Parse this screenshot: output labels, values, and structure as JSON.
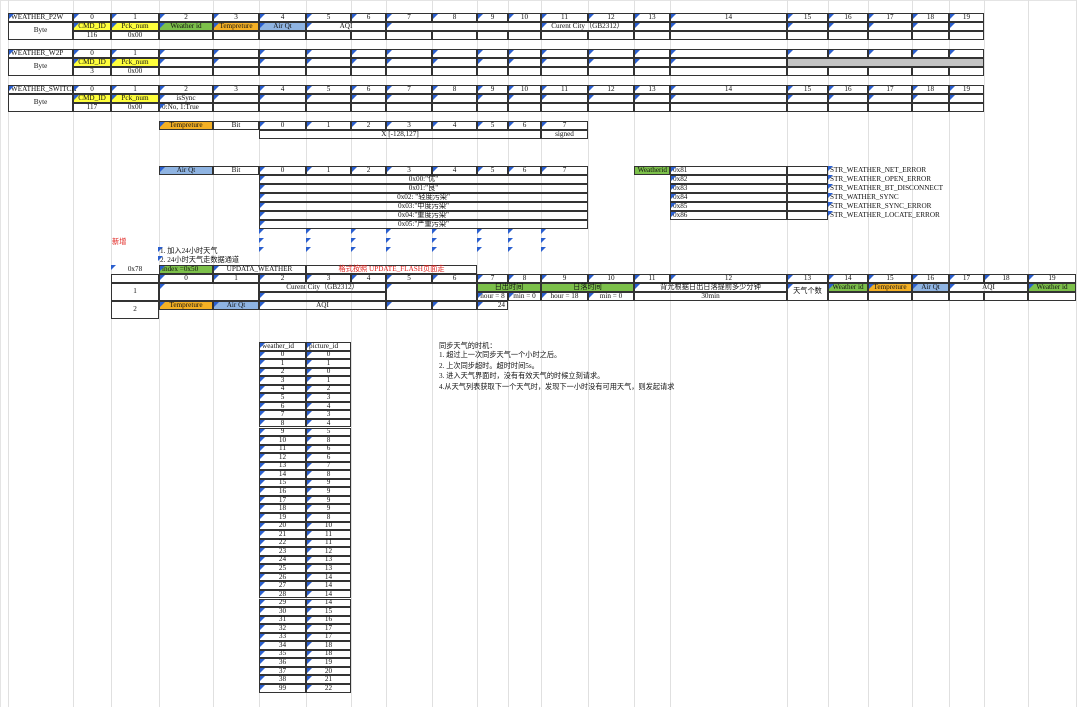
{
  "tables": {
    "p2w": {
      "name": "WEATHER_P2W",
      "index_label": "Byte",
      "byte_headers": [
        "0",
        "1",
        "2",
        "3",
        "4",
        "5",
        "6",
        "7",
        "8",
        "9",
        "10",
        "11",
        "12",
        "13",
        "14",
        "15",
        "16",
        "17",
        "18",
        "19"
      ],
      "row1": {
        "cmd_id": "CMD_ID",
        "pck_num": "Pck_num",
        "weather_id": "Weather id",
        "temp": "Tempreture",
        "air_qt": "Air Qt",
        "aqi": "AQI",
        "city": "Curent City（GB2312）"
      },
      "row2": {
        "cmd_val": "116",
        "pck_val": "0x00"
      }
    },
    "w2p": {
      "name": "WEATHER_W2P",
      "index_label": "Byte",
      "byte_headers": [
        "0",
        "1"
      ],
      "row1": {
        "cmd_id": "CMD_ID",
        "pck_num": "Pck_num"
      },
      "row2": {
        "cmd_val": "3",
        "pck_val": "0x00"
      }
    },
    "switch": {
      "name": "WEATHER_SWITCH",
      "index_label": "Byte",
      "byte_headers": [
        "0",
        "1",
        "2",
        "3",
        "4",
        "5",
        "6",
        "7",
        "8",
        "9",
        "10",
        "11",
        "12",
        "13",
        "14",
        "15",
        "16",
        "17",
        "18",
        "19"
      ],
      "row1": {
        "cmd_id": "CMD_ID",
        "pck_num": "Pck_num",
        "is_sync": "isSync"
      },
      "row2": {
        "cmd_val": "117",
        "pck_val": "0x00",
        "sync_val": "0:No, 1:True"
      }
    },
    "temp_bits": {
      "label": "Tempreture",
      "bit_label": "Bit",
      "bits": [
        "0",
        "1",
        "2",
        "3",
        "4",
        "5",
        "6",
        "7"
      ],
      "range": "X [-128,127]",
      "signed": "signed"
    },
    "air_bits": {
      "label": "Air Qt",
      "bit_label": "Bit",
      "bits": [
        "0",
        "1",
        "2",
        "3",
        "4",
        "5",
        "6",
        "7"
      ],
      "values": [
        "0x00:\"优\"",
        "0x01:\"良\"",
        "0x02: \"轻度污染\"",
        "0x03:\"中度污染\"",
        "0x04:\"重度污染\"",
        "0x05:\"严重污染\""
      ]
    },
    "errors": {
      "label": "Weatherid",
      "items": [
        {
          "code": "0x81",
          "name": "STR_WEATHER_NET_ERROR"
        },
        {
          "code": "0x82",
          "name": "STR_WEATHER_OPEN_ERROR"
        },
        {
          "code": "0x83",
          "name": "STR_WEATHER_BT_DISCONNECT"
        },
        {
          "code": "0x84",
          "name": "STR_WATHER_SYNC"
        },
        {
          "code": "0x85",
          "name": "STR_WEATHER_SYNC_ERROR"
        },
        {
          "code": "0x86",
          "name": "STR_WEATHER_LOCATE_ERROR"
        }
      ]
    },
    "update": {
      "new_label": "新增",
      "notes": [
        "1. 加入24小时天气",
        "2. 24小时天气走数据通道"
      ],
      "code": "0x78",
      "index_label": "index =0x50",
      "cmd_name": "UPDATA_WEATHER",
      "format_note": "格式按照 UPDATE_FLASH页面走",
      "byte_headers": [
        "0",
        "1",
        "2",
        "3",
        "4",
        "5",
        "6",
        "7",
        "8",
        "9",
        "10",
        "11",
        "12",
        "13",
        "14",
        "15",
        "16",
        "17",
        "18",
        "19"
      ],
      "row1": {
        "index": "1",
        "city": "Curent City（GB2312）",
        "sunrise": "日出时间",
        "sunset": "日落时间",
        "hour8": "hour = 8",
        "min0a": "min = 0",
        "hour18": "hour = 18",
        "min0b": "min = 0",
        "backlight": "背光根据日出日落提前多少分钟",
        "backlight_val": "30min",
        "count": "天气个数",
        "weather_id": "Weather id",
        "temp": "Tempreture",
        "air_qt": "Air Qt",
        "aqi": "AQI",
        "weather_id2": "Weather id"
      },
      "row2": {
        "index": "2",
        "temp": "Tempreture",
        "air_qt": "Air Qt",
        "aqi": "AQI",
        "count": "24"
      }
    },
    "mapping": {
      "headers": [
        "weather_id",
        "picture_id"
      ],
      "rows": [
        [
          "0",
          "0"
        ],
        [
          "1",
          "1"
        ],
        [
          "2",
          "0"
        ],
        [
          "3",
          "1"
        ],
        [
          "4",
          "2"
        ],
        [
          "5",
          "3"
        ],
        [
          "6",
          "4"
        ],
        [
          "7",
          "3"
        ],
        [
          "8",
          "4"
        ],
        [
          "9",
          "5"
        ],
        [
          "10",
          "8"
        ],
        [
          "11",
          "6"
        ],
        [
          "12",
          "6"
        ],
        [
          "13",
          "7"
        ],
        [
          "14",
          "8"
        ],
        [
          "15",
          "9"
        ],
        [
          "16",
          "9"
        ],
        [
          "17",
          "9"
        ],
        [
          "18",
          "9"
        ],
        [
          "19",
          "8"
        ],
        [
          "20",
          "10"
        ],
        [
          "21",
          "11"
        ],
        [
          "22",
          "11"
        ],
        [
          "23",
          "12"
        ],
        [
          "24",
          "13"
        ],
        [
          "25",
          "13"
        ],
        [
          "26",
          "14"
        ],
        [
          "27",
          "14"
        ],
        [
          "28",
          "14"
        ],
        [
          "29",
          "14"
        ],
        [
          "30",
          "15"
        ],
        [
          "31",
          "16"
        ],
        [
          "32",
          "17"
        ],
        [
          "33",
          "17"
        ],
        [
          "34",
          "18"
        ],
        [
          "35",
          "18"
        ],
        [
          "36",
          "19"
        ],
        [
          "37",
          "20"
        ],
        [
          "38",
          "21"
        ],
        [
          "99",
          "22"
        ]
      ]
    },
    "sync_notes": {
      "title": "同步天气的时机：",
      "lines": [
        "1. 超过上一次同步天气一个小时之后。",
        "2. 上次同步超时。超时时间5s。",
        "3. 进入天气界面时，没有有效天气的时候立刻请求。",
        "4.从天气列表获取下一个天气时，发现下一小时没有可用天气，则发起请求"
      ]
    }
  },
  "colors": {
    "yellow": "#ffff3c",
    "orange": "#f4b024",
    "green": "#7cc04a",
    "blue": "#8fb4e2",
    "red": "#e0201c"
  }
}
